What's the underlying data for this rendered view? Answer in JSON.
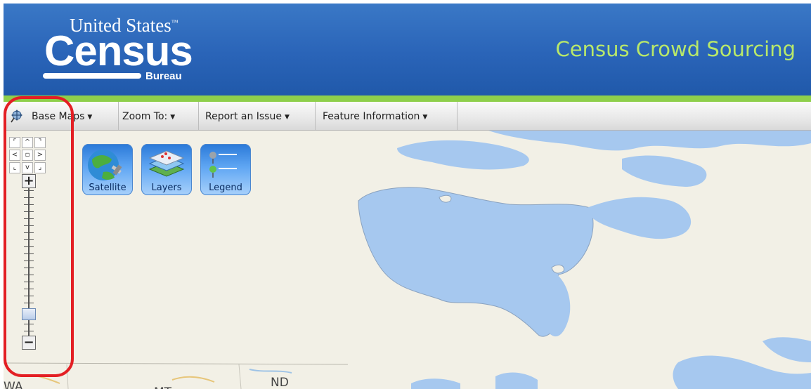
{
  "header": {
    "logo": {
      "top_line": "United States",
      "trademark": "™",
      "main": "Census",
      "sub": "Bureau"
    },
    "app_title": "Census Crowd Sourcing"
  },
  "toolbar": {
    "items": [
      {
        "label": "Base Maps",
        "icon": "pan-icon"
      },
      {
        "label": "Zoom To:"
      },
      {
        "label": "Report an Issue"
      },
      {
        "label": "Feature Information"
      }
    ]
  },
  "map": {
    "state_labels": [
      "WA",
      "MT",
      "ND"
    ],
    "navigation": {
      "pan_buttons": [
        "pan-up-left",
        "pan-up",
        "pan-up-right",
        "pan-left",
        "pan-center",
        "pan-right",
        "pan-down-left",
        "pan-down",
        "pan-down-right"
      ],
      "zoom_level_fraction": 0.12
    },
    "tools": [
      {
        "label": "Satellite",
        "icon": "satellite-icon"
      },
      {
        "label": "Layers",
        "icon": "layers-icon"
      },
      {
        "label": "Legend",
        "icon": "legend-icon"
      }
    ]
  },
  "colors": {
    "header_blue": "#2a64b8",
    "title_green": "#b8e86a",
    "accent_green": "#8ecf4b",
    "water": "#a6c8ef",
    "land": "#f2f0e6",
    "highlight_red": "#e31f24"
  }
}
